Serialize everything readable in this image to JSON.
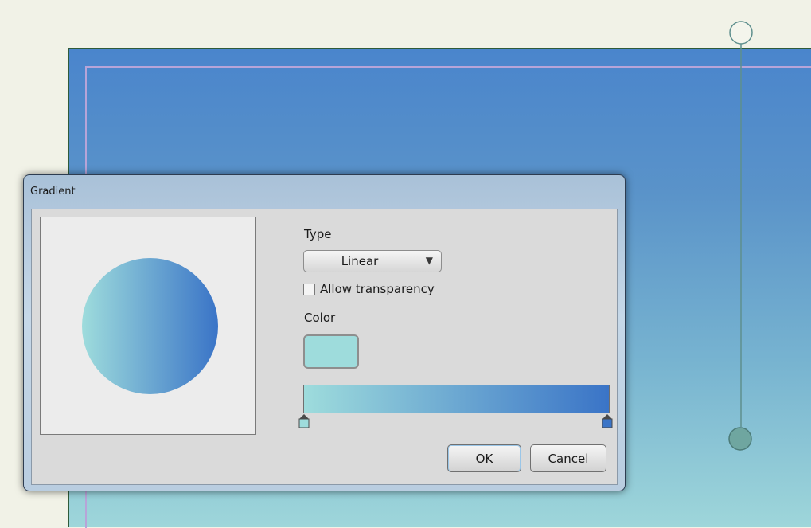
{
  "dialog": {
    "title": "Gradient",
    "type_label": "Type",
    "type_value": "Linear",
    "type_arrow": "▼",
    "allow_transparency_label": "Allow transparency",
    "allow_transparency_checked": false,
    "color_label": "Color",
    "selected_color": "#9edcdc",
    "gradient_start": "#9edcdc",
    "gradient_end": "#3a74c7",
    "ok_label": "OK",
    "cancel_label": "Cancel"
  },
  "icons": {
    "dropdown": "chevron-down-icon",
    "handle_top": "gradient-handle-start-icon",
    "handle_bottom": "gradient-handle-end-icon",
    "stop": "gradient-stop-icon"
  }
}
